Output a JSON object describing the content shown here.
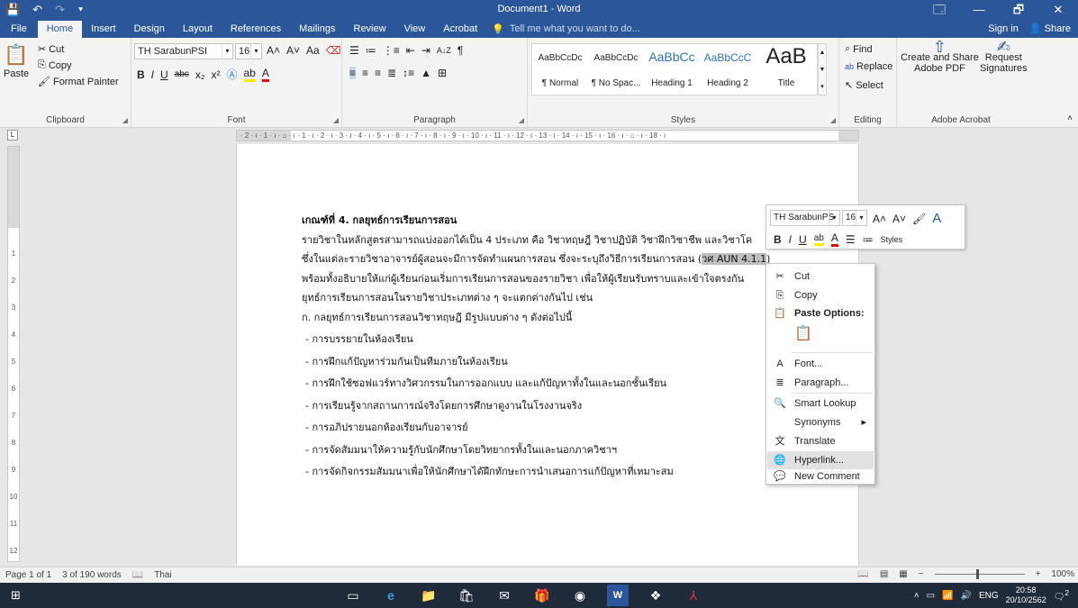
{
  "window": {
    "title": "Document1 - Word"
  },
  "qat": {
    "save_icon": "💾",
    "undo_icon": "↶",
    "redo_icon": "↷",
    "more_icon": "⯆"
  },
  "controls": {
    "ribbon_display": "🗔",
    "minimize": "—",
    "restore": "🗗",
    "close": "✕"
  },
  "tabs": [
    {
      "label": "File"
    },
    {
      "label": "Home"
    },
    {
      "label": "Insert"
    },
    {
      "label": "Design"
    },
    {
      "label": "Layout"
    },
    {
      "label": "References"
    },
    {
      "label": "Mailings"
    },
    {
      "label": "Review"
    },
    {
      "label": "View"
    },
    {
      "label": "Acrobat"
    }
  ],
  "tell_me": "Tell me what you want to do...",
  "sign_in": "Sign in",
  "share": "Share",
  "ribbon": {
    "clipboard": {
      "paste": "Paste",
      "cut": "Cut",
      "copy": "Copy",
      "format_painter": "Format Painter",
      "label": "Clipboard"
    },
    "font": {
      "name": "TH SarabunPSI",
      "size": "16",
      "label": "Font",
      "grow": "A˄",
      "shrink": "A˅",
      "case": "Aa",
      "bold": "B",
      "italic": "I",
      "underline": "U",
      "strike": "abc",
      "sub": "x₂",
      "sup": "x²"
    },
    "paragraph": {
      "label": "Paragraph",
      "sort": "A↓Z",
      "marks": "¶"
    },
    "styles": {
      "label": "Styles",
      "items": [
        {
          "preview": "AaBbCcDc",
          "name": "¶ Normal"
        },
        {
          "preview": "AaBbCcDc",
          "name": "¶ No Spac..."
        },
        {
          "preview": "AaBbCc",
          "name": "Heading 1"
        },
        {
          "preview": "AaBbCcC",
          "name": "Heading 2"
        },
        {
          "preview": "AaB",
          "name": "Title"
        }
      ]
    },
    "editing": {
      "find": "Find",
      "replace": "Replace",
      "select": "Select",
      "label": "Editing"
    },
    "acrobat": {
      "create_share": "Create and Share",
      "adobe_pdf": "Adobe PDF",
      "request": "Request",
      "signatures": "Signatures",
      "label": "Adobe Acrobat"
    }
  },
  "ruler": {
    "text": "· 2 · ı · 1 · ı · ⌂ · ı · 1 · ı · 2 · ı · 3 · ı · 4 · ı · 5 · ı · 6 · ı · 7 · ı · 8 · ı · 9 · ı · 10 · ı · 11 · ı · 12 · ı · 13 · ı · 14 · ı · 15 · ı · 16 · ı · ⌂ · ı · 18 · ı"
  },
  "vruler": {
    "ticks": [
      "1",
      "2",
      "3",
      "4",
      "5",
      "6",
      "7",
      "8",
      "9",
      "10",
      "11",
      "12"
    ]
  },
  "document": {
    "heading": "เกณฑ์ที่ 4. กลยุทธ์การเรียนการสอน",
    "line1": "รายวิชาในหลักสูตรสามารถแบ่งออกได้เป็น 4 ประเภท คือ วิชาทฤษฎี วิชาปฏิบัติ วิชาฝึกวิชาชีพ และวิชาโค",
    "line2_pre": "ซึ่งในแต่ละรายวิชาอาจารย์ผู้สอนจะมีการจัดทำแผนการสอน ซึ่งจะระบุถึงวิธีการเรียนการสอน (",
    "line2_sel": "วศ AUN 4.1.1",
    "line2_post": ")",
    "line3": "พร้อมทั้งอธิบายให้แก่ผู้เรียนก่อนเริ่มการเรียนการสอนของรายวิชา เพื่อให้ผู้เรียนรับทราบและเข้าใจตรงกัน",
    "line4": "ยุทธ์การเรียนการสอนในรายวิชาประเภทต่าง ๆ จะแตกต่างกันไป เช่น",
    "line5": "ก. กลยุทธ์การเรียนการสอนวิชาทฤษฎี มีรูปแบบต่าง ๆ ดังต่อไปนี้",
    "bullets": [
      "- การบรรยายในห้องเรียน",
      "- การฝึกแก้ปัญหาร่วมกันเป็นทีมภายในห้องเรียน",
      "- การฝึกใช้ซอฟแวร์ทางวิศวกรรมในการออกแบบ และแก้ปัญหาทั้งในและนอกชั้นเรียน",
      "- การเรียนรู้จากสถานการณ์จริงโดยการศึกษาดูงานในโรงงานจริง",
      "- การอภิปรายนอกห้องเรียนกับอาจารย์",
      "- การจัดสัมมนาให้ความรู้กับนักศึกษาโดยวิทยากรทั้งในและนอกภาควิชาฯ",
      "- การจัดกิจกรรมสัมมนาเพื่อให้นักศึกษาได้ฝึกทักษะการนำเสนอการแก้ปัญหาที่เหมาะสม"
    ]
  },
  "mini_toolbar": {
    "font": "TH SarabunPS",
    "size": "16",
    "styles": "Styles"
  },
  "context_menu": {
    "items": [
      {
        "icon": "✂",
        "label": "Cut"
      },
      {
        "icon": "⎘",
        "label": "Copy"
      },
      {
        "icon": "📋",
        "label": "Paste Options:"
      },
      {
        "icon": "📋",
        "label": ""
      },
      {
        "icon": "A",
        "label": "Font..."
      },
      {
        "icon": "≣",
        "label": "Paragraph..."
      },
      {
        "icon": "🔍",
        "label": "Smart Lookup"
      },
      {
        "icon": "",
        "label": "Synonyms",
        "arrow": "▸"
      },
      {
        "icon": "文",
        "label": "Translate"
      },
      {
        "icon": "🌐",
        "label": "Hyperlink..."
      },
      {
        "icon": "💬",
        "label": "New Comment"
      }
    ]
  },
  "status": {
    "page": "Page 1 of 1",
    "words": "3 of 190 words",
    "lang": "Thai",
    "zoom": "100%"
  },
  "taskbar": {
    "lang": "ENG",
    "time": "20:58",
    "date": "20/10/2562",
    "notif": "2"
  }
}
